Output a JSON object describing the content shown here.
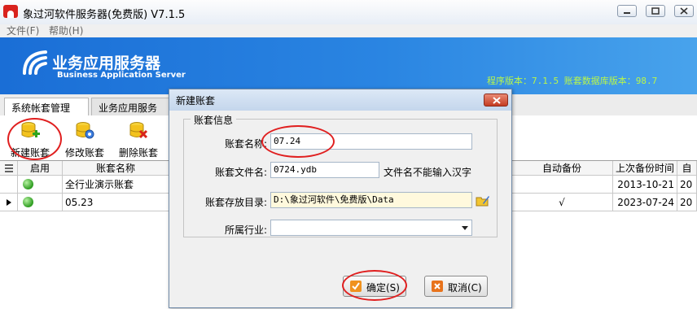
{
  "window": {
    "title": "象过河软件服务器(免费版) V7.1.5"
  },
  "menu": [
    {
      "label": "文件(F)"
    },
    {
      "label": "帮助(H)"
    }
  ],
  "banner": {
    "title": "业务应用服务器",
    "subtitle": "Business Application Server",
    "version_text": "程序版本：7.1.5  账套数据库版本：98.7"
  },
  "tabs": [
    {
      "label": "系统帐套管理"
    },
    {
      "label": "业务应用服务"
    }
  ],
  "toolbar": {
    "new": "新建账套",
    "edit": "修改账套",
    "delete": "删除账套"
  },
  "grid": {
    "headers": {
      "enabled": "启用",
      "name": "账套名称",
      "auto_backup": "自动备份",
      "last_backup": "上次备份时间",
      "next": "自"
    },
    "rows": [
      {
        "name": "全行业演示账套",
        "auto_backup": "",
        "last_backup": "2013-10-21",
        "next": "20"
      },
      {
        "name": "05.23",
        "auto_backup": "√",
        "last_backup": "2023-07-24",
        "next": "20"
      }
    ]
  },
  "dialog": {
    "title": "新建账套",
    "group_title": "账套信息",
    "name_label": "账套名称:",
    "name_value": "07.24",
    "file_label": "账套文件名:",
    "file_value": "0724.ydb",
    "file_hint": "文件名不能输入汉字",
    "dir_label": "账套存放目录:",
    "dir_value": "D:\\象过河软件\\免费版\\Data",
    "industry_label": "所属行业:",
    "industry_value": "",
    "ok_label": "确定(S)",
    "cancel_label": "取消(C)"
  },
  "colors": {
    "banner": "#2a85e2",
    "version_text": "#b9f64a",
    "annotation": "#e01f1f",
    "enabled_dot": "#2c9b1e"
  }
}
